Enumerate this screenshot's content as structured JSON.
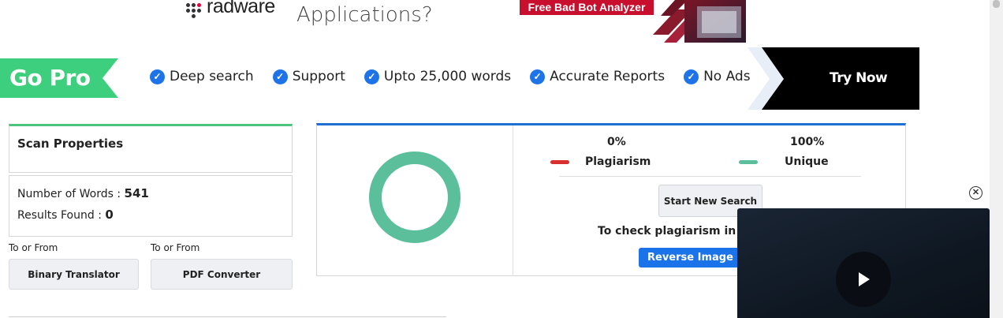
{
  "ad": {
    "brand": "radware",
    "headline": "Applications?",
    "cta": "Free Bad Bot Analyzer"
  },
  "gopro": {
    "label": "Go Pro",
    "features": [
      {
        "label": "Deep search"
      },
      {
        "label": "Support"
      },
      {
        "label": "Upto 25,000 words"
      },
      {
        "label": "Accurate Reports"
      },
      {
        "label": "No Ads"
      }
    ],
    "try_now": "Try Now"
  },
  "scan": {
    "title": "Scan Properties",
    "words_label": "Number of Words : ",
    "words_value": "541",
    "results_label": "Results Found : ",
    "results_value": "0"
  },
  "tools": [
    {
      "caption": "To or From",
      "button": "Binary Translator"
    },
    {
      "caption": "To or From",
      "button": "PDF Converter"
    }
  ],
  "result": {
    "plagiarism_pct": "0%",
    "plagiarism_label": "Plagiarism",
    "unique_pct": "100%",
    "unique_label": "Unique",
    "start_new": "Start New Search",
    "check_text": "To check plagiarism in ph",
    "reverse_btn": "Reverse Image S"
  },
  "colors": {
    "accent_green": "#4cc47d",
    "ring": "#5bbf9b",
    "plagiarism": "#d93030",
    "unique": "#5bbf9b",
    "blue": "#1a73e8",
    "go_pro_bg": "#3ecf7e"
  },
  "icons": {
    "feature_check": "check-circle-icon",
    "play": "play-icon",
    "close": "close-circle-icon"
  }
}
